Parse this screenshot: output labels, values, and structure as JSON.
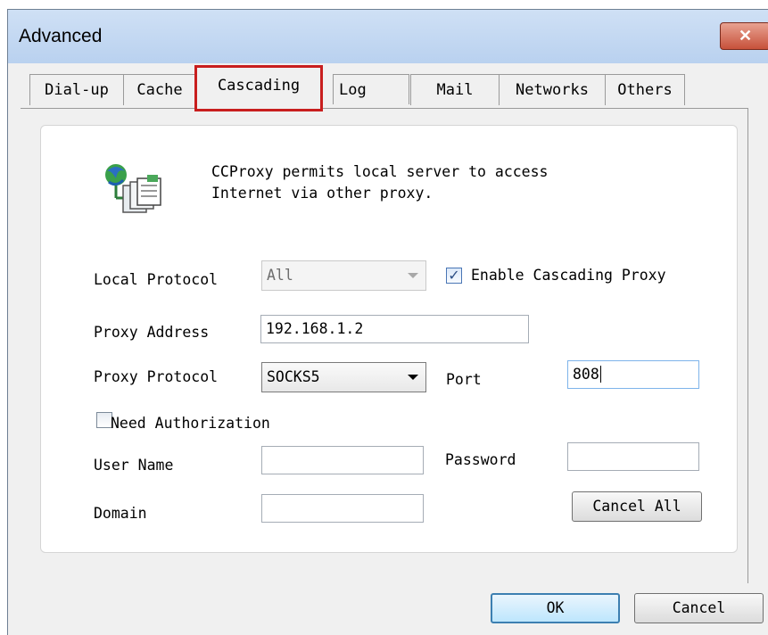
{
  "window": {
    "title": "Advanced",
    "close_label": "✕"
  },
  "tabs": [
    {
      "label": "Dial-up"
    },
    {
      "label": "Cache"
    },
    {
      "label": "Cascading"
    },
    {
      "label": "Log"
    },
    {
      "label": "Mail"
    },
    {
      "label": "Networks"
    },
    {
      "label": "Others"
    }
  ],
  "active_tab": "Cascading",
  "info": {
    "text": "CCProxy permits local server to access\nInternet via other proxy."
  },
  "form": {
    "local_protocol": {
      "label": "Local Protocol",
      "value": "All"
    },
    "enable_cascading": {
      "label": "Enable Cascading Proxy",
      "checked": true
    },
    "proxy_address": {
      "label": "Proxy Address",
      "value": "192.168.1.2"
    },
    "proxy_protocol": {
      "label": "Proxy Protocol",
      "value": "SOCKS5"
    },
    "port": {
      "label": "Port",
      "value": "808"
    },
    "need_auth": {
      "label": "Need Authorization",
      "checked": false
    },
    "user_name": {
      "label": "User Name",
      "value": ""
    },
    "password": {
      "label": "Password",
      "value": ""
    },
    "domain": {
      "label": "Domain",
      "value": ""
    },
    "cancel_all_label": "Cancel All"
  },
  "buttons": {
    "ok_label": "OK",
    "cancel_label": "Cancel"
  },
  "colors": {
    "active_tab_highlight": "#c81e1e",
    "close_button": "#c7513a",
    "titlebar": "#b9d1ef"
  }
}
